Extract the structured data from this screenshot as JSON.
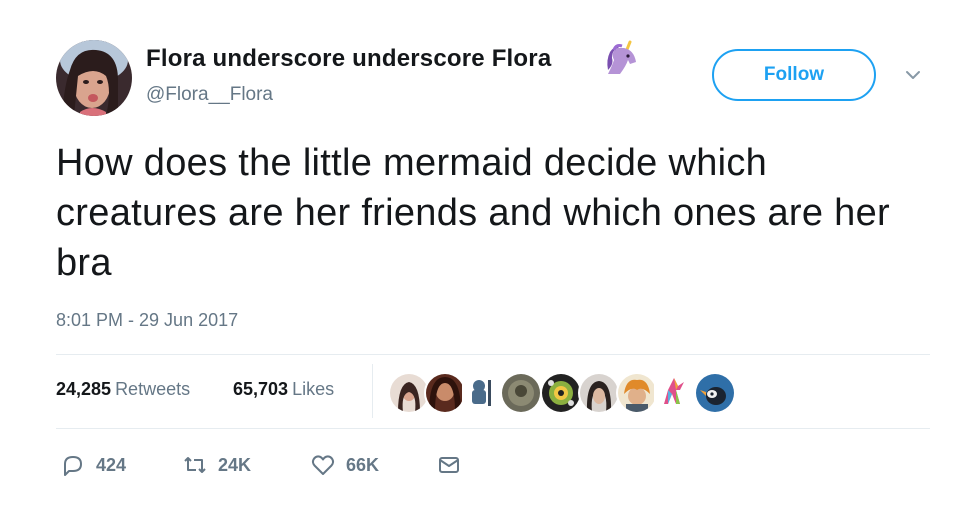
{
  "author": {
    "display_name": "Flora underscore underscore Flora",
    "handle": "@Flora__Flora",
    "badge_icon": "unicorn-icon",
    "avatar_icon": "avatar-photo"
  },
  "header": {
    "follow_label": "Follow",
    "menu_icon": "chevron-down-icon"
  },
  "tweet": {
    "text": "How does the little mermaid decide which creatures are her friends and which ones are her bra",
    "timestamp": "8:01 PM - 29 Jun 2017"
  },
  "stats": {
    "retweets_count": "24,285",
    "retweets_label": "Retweets",
    "likes_count": "65,703",
    "likes_label": "Likes"
  },
  "likers": [
    "liker-avatar-1",
    "liker-avatar-2",
    "liker-avatar-3",
    "liker-avatar-4",
    "liker-avatar-5",
    "liker-avatar-6",
    "liker-avatar-7",
    "liker-avatar-8",
    "liker-avatar-9",
    "liker-avatar-10"
  ],
  "actions": {
    "reply_count": "424",
    "retweet_count": "24K",
    "like_count": "66K"
  },
  "colors": {
    "accent": "#1da1f2",
    "muted": "#657786",
    "text": "#14171a",
    "divider": "#e6ecf0"
  }
}
